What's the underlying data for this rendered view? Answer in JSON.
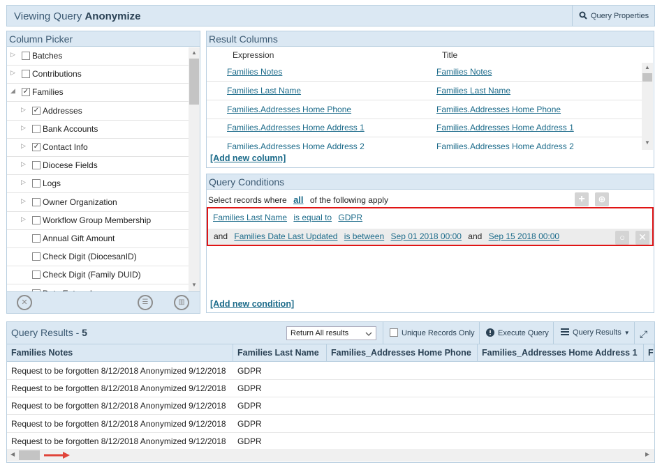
{
  "header": {
    "prefix": "Viewing Query ",
    "query_name": "Anonymize",
    "query_properties_label": "Query Properties"
  },
  "column_picker": {
    "title": "Column Picker",
    "items": [
      {
        "label": "Batches",
        "checked": false,
        "expandable": true,
        "expanded": false,
        "indent": 0
      },
      {
        "label": "Contributions",
        "checked": false,
        "expandable": true,
        "expanded": false,
        "indent": 0
      },
      {
        "label": "Families",
        "checked": true,
        "expandable": true,
        "expanded": true,
        "indent": 0
      },
      {
        "label": "Addresses",
        "checked": true,
        "expandable": true,
        "expanded": false,
        "indent": 1
      },
      {
        "label": "Bank Accounts",
        "checked": false,
        "expandable": true,
        "expanded": false,
        "indent": 1
      },
      {
        "label": "Contact Info",
        "checked": true,
        "expandable": true,
        "expanded": false,
        "indent": 1
      },
      {
        "label": "Diocese Fields",
        "checked": false,
        "expandable": true,
        "expanded": false,
        "indent": 1
      },
      {
        "label": "Logs",
        "checked": false,
        "expandable": true,
        "expanded": false,
        "indent": 1
      },
      {
        "label": "Owner Organization",
        "checked": false,
        "expandable": true,
        "expanded": false,
        "indent": 1
      },
      {
        "label": "Workflow Group Membership",
        "checked": false,
        "expandable": true,
        "expanded": false,
        "indent": 1
      },
      {
        "label": "Annual Gift Amount",
        "checked": false,
        "expandable": false,
        "expanded": false,
        "indent": 1
      },
      {
        "label": "Check Digit (DiocesanID)",
        "checked": false,
        "expandable": false,
        "expanded": false,
        "indent": 1
      },
      {
        "label": "Check Digit (Family DUID)",
        "checked": false,
        "expandable": false,
        "expanded": false,
        "indent": 1
      },
      {
        "label": "Date Entered",
        "checked": false,
        "expandable": false,
        "expanded": false,
        "indent": 1
      }
    ]
  },
  "result_columns": {
    "title": "Result Columns",
    "expression_header": "Expression",
    "title_header": "Title",
    "rows": [
      {
        "expression": "Families Notes",
        "title": "Families Notes"
      },
      {
        "expression": "Families Last Name",
        "title": "Families Last Name"
      },
      {
        "expression": "Families.Addresses Home Phone",
        "title": "Families.Addresses Home Phone"
      },
      {
        "expression": "Families.Addresses Home Address 1",
        "title": "Families.Addresses Home Address 1"
      },
      {
        "expression": "Families.Addresses Home Address 2",
        "title": "Families.Addresses Home Address 2"
      }
    ],
    "add_label": "[Add new column]"
  },
  "query_conditions": {
    "title": "Query Conditions",
    "select_prefix": "Select records where",
    "match_mode": "all",
    "select_suffix": "of the following apply",
    "condition1": {
      "field": "Families Last Name",
      "operator": "is equal to",
      "value": "GDPR"
    },
    "condition2": {
      "conjunction": "and",
      "field": "Families Date Last Updated",
      "operator": "is between",
      "value1": "Sep 01 2018 00:00",
      "and": "and",
      "value2": "Sep 15 2018 00:00"
    },
    "add_label": "[Add new condition]"
  },
  "query_results": {
    "title": "Query Results - ",
    "count": "5",
    "return_select": "Return All results",
    "unique_label": "Unique Records Only",
    "execute_label": "Execute Query",
    "results_menu_label": "Query Results",
    "columns": [
      "Families Notes",
      "Families Last Name",
      "Families_Addresses Home Phone",
      "Families_Addresses Home Address 1",
      "Fa"
    ],
    "rows": [
      [
        "Request to be forgotten 8/12/2018 Anonymized 9/12/2018",
        "GDPR"
      ],
      [
        "Request to be forgotten 8/12/2018 Anonymized 9/12/2018",
        "GDPR"
      ],
      [
        "Request to be forgotten 8/12/2018 Anonymized 9/12/2018",
        "GDPR"
      ],
      [
        "Request to be forgotten 8/12/2018 Anonymized 9/12/2018",
        "GDPR"
      ],
      [
        "Request to be forgotten 8/12/2018 Anonymized 9/12/2018",
        "GDPR"
      ]
    ]
  },
  "colors": {
    "header_bg": "#dbe8f3",
    "border": "#b9cfe0",
    "link": "#1c6b8a",
    "highlight_box": "#e01414",
    "annotation_arrow": "#e0443a"
  }
}
